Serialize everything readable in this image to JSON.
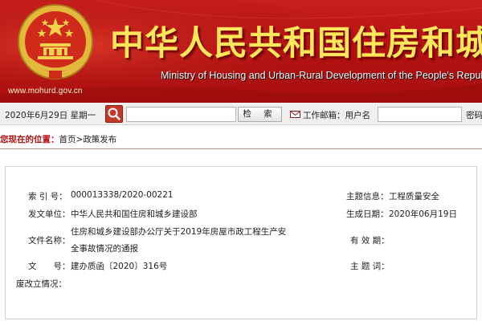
{
  "banner": {
    "title_cn": "中华人民共和国住房和城乡建设部",
    "title_en": "Ministry of Housing and Urban-Rural Development of the People's Republic of China",
    "url": "www.mohurd.gov.cn",
    "emblem_icon": "national-emblem-icon",
    "colors": {
      "background": "#b51212",
      "title": "#ffe65a"
    }
  },
  "topbar": {
    "date": "2020年6月29日 星期一",
    "search_icon": "search-icon",
    "search_placeholder": "",
    "search_button": "检 索",
    "mail_icon": "envelope-icon",
    "mail_label": "工作邮箱：用户名",
    "password_label": "密码"
  },
  "breadcrumb": {
    "label": "您现在的位置：",
    "items": [
      "首页",
      "政策发布"
    ],
    "separator": ">"
  },
  "info": {
    "index_label": "索 引 号：",
    "index_value": "000013338/2020-00221",
    "topic_label": "主题信息：",
    "topic_value": "工程质量安全",
    "issuer_label": "发文单位：",
    "issuer_value": "中华人民共和国住房和城乡建设部",
    "date_label": "生成日期：",
    "date_value": "2020年06月19日",
    "title_label": "文件名称：",
    "title_value_line1": "住房和城乡建设部办公厅关于2019年房屋市政工程生产安",
    "title_value_line2": "全事故情况的通报",
    "validity_label": "有 效 期：",
    "validity_value": "",
    "docno_label": "文　　号：",
    "docno_value": "建办质函〔2020〕316号",
    "subject_label": "主 题 词：",
    "subject_value": "",
    "abolish_label": "废改立情况：",
    "abolish_value": ""
  }
}
